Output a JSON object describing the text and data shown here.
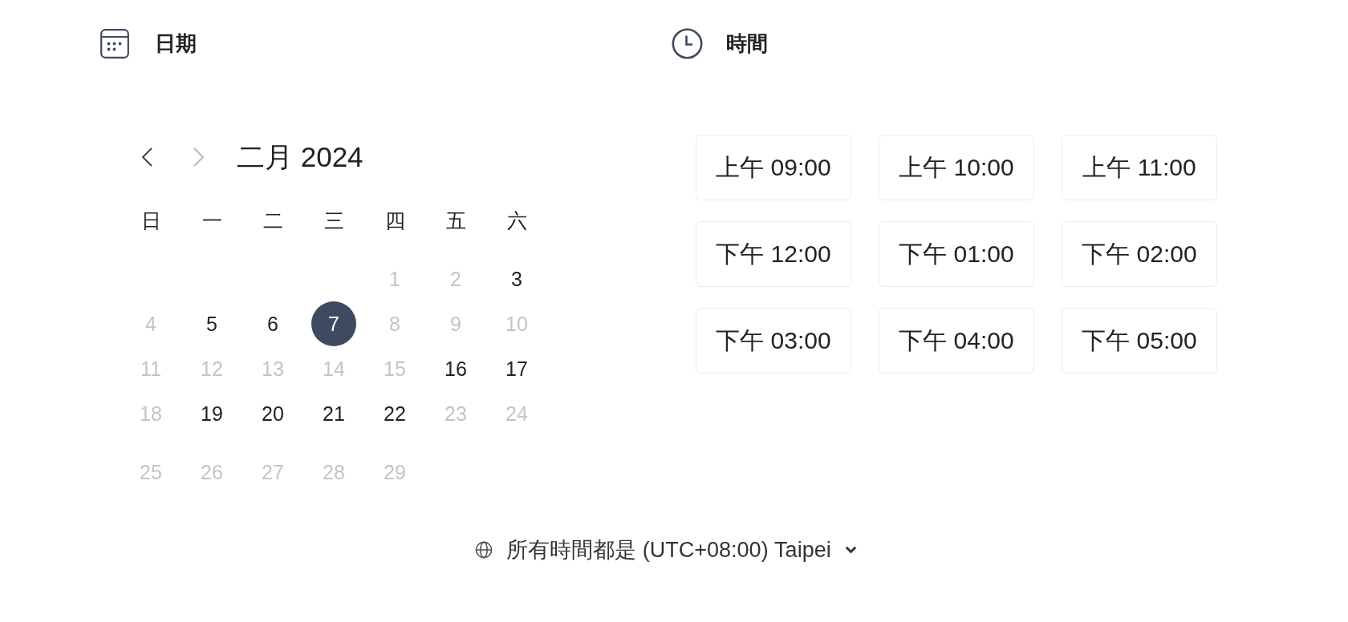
{
  "date_section": {
    "title": "日期"
  },
  "time_section": {
    "title": "時間"
  },
  "calendar": {
    "nav_buttons": [
      {
        "kind": "prev",
        "disabled": false
      },
      {
        "kind": "next",
        "disabled": true
      }
    ],
    "month_title": "二月 2024",
    "weekdays": [
      "日",
      "一",
      "二",
      "三",
      "四",
      "五",
      "六"
    ],
    "weeks": [
      {
        "kind": "leading",
        "days": [
          {
            "label": "1",
            "disabled": true,
            "selected": false
          },
          {
            "label": "2",
            "disabled": true,
            "selected": false
          },
          {
            "label": "3",
            "disabled": false,
            "selected": false
          }
        ]
      },
      {
        "kind": "full",
        "days": [
          {
            "label": "4",
            "disabled": true,
            "selected": false
          },
          {
            "label": "5",
            "disabled": false,
            "selected": false
          },
          {
            "label": "6",
            "disabled": false,
            "selected": false
          },
          {
            "label": "7",
            "disabled": false,
            "selected": true
          },
          {
            "label": "8",
            "disabled": true,
            "selected": false
          },
          {
            "label": "9",
            "disabled": true,
            "selected": false
          },
          {
            "label": "10",
            "disabled": true,
            "selected": false
          }
        ]
      },
      {
        "kind": "full",
        "days": [
          {
            "label": "11",
            "disabled": true,
            "selected": false
          },
          {
            "label": "12",
            "disabled": true,
            "selected": false
          },
          {
            "label": "13",
            "disabled": true,
            "selected": false
          },
          {
            "label": "14",
            "disabled": true,
            "selected": false
          },
          {
            "label": "15",
            "disabled": true,
            "selected": false
          },
          {
            "label": "16",
            "disabled": false,
            "selected": false
          },
          {
            "label": "17",
            "disabled": false,
            "selected": false
          }
        ]
      },
      {
        "kind": "full",
        "days": [
          {
            "label": "18",
            "disabled": true,
            "selected": false
          },
          {
            "label": "19",
            "disabled": false,
            "selected": false
          },
          {
            "label": "20",
            "disabled": false,
            "selected": false
          },
          {
            "label": "21",
            "disabled": false,
            "selected": false
          },
          {
            "label": "22",
            "disabled": false,
            "selected": false
          },
          {
            "label": "23",
            "disabled": true,
            "selected": false
          },
          {
            "label": "24",
            "disabled": true,
            "selected": false
          }
        ]
      },
      {
        "kind": "trailing",
        "days": [
          {
            "label": "25",
            "disabled": true,
            "selected": false
          },
          {
            "label": "26",
            "disabled": true,
            "selected": false
          },
          {
            "label": "27",
            "disabled": true,
            "selected": false
          },
          {
            "label": "28",
            "disabled": true,
            "selected": false
          },
          {
            "label": "29",
            "disabled": true,
            "selected": false
          }
        ]
      }
    ]
  },
  "time_slots": [
    {
      "label": "上午 09:00",
      "selected": false
    },
    {
      "label": "上午 10:00",
      "selected": false
    },
    {
      "label": "上午 11:00",
      "selected": false
    },
    {
      "label": "下午 12:00",
      "selected": false
    },
    {
      "label": "下午 01:00",
      "selected": false
    },
    {
      "label": "下午 02:00",
      "selected": false
    },
    {
      "label": "下午 03:00",
      "selected": false
    },
    {
      "label": "下午 04:00",
      "selected": false
    },
    {
      "label": "下午 05:00",
      "selected": false
    }
  ],
  "timezone": {
    "label": "所有時間都是 (UTC+08:00) Taipei"
  }
}
